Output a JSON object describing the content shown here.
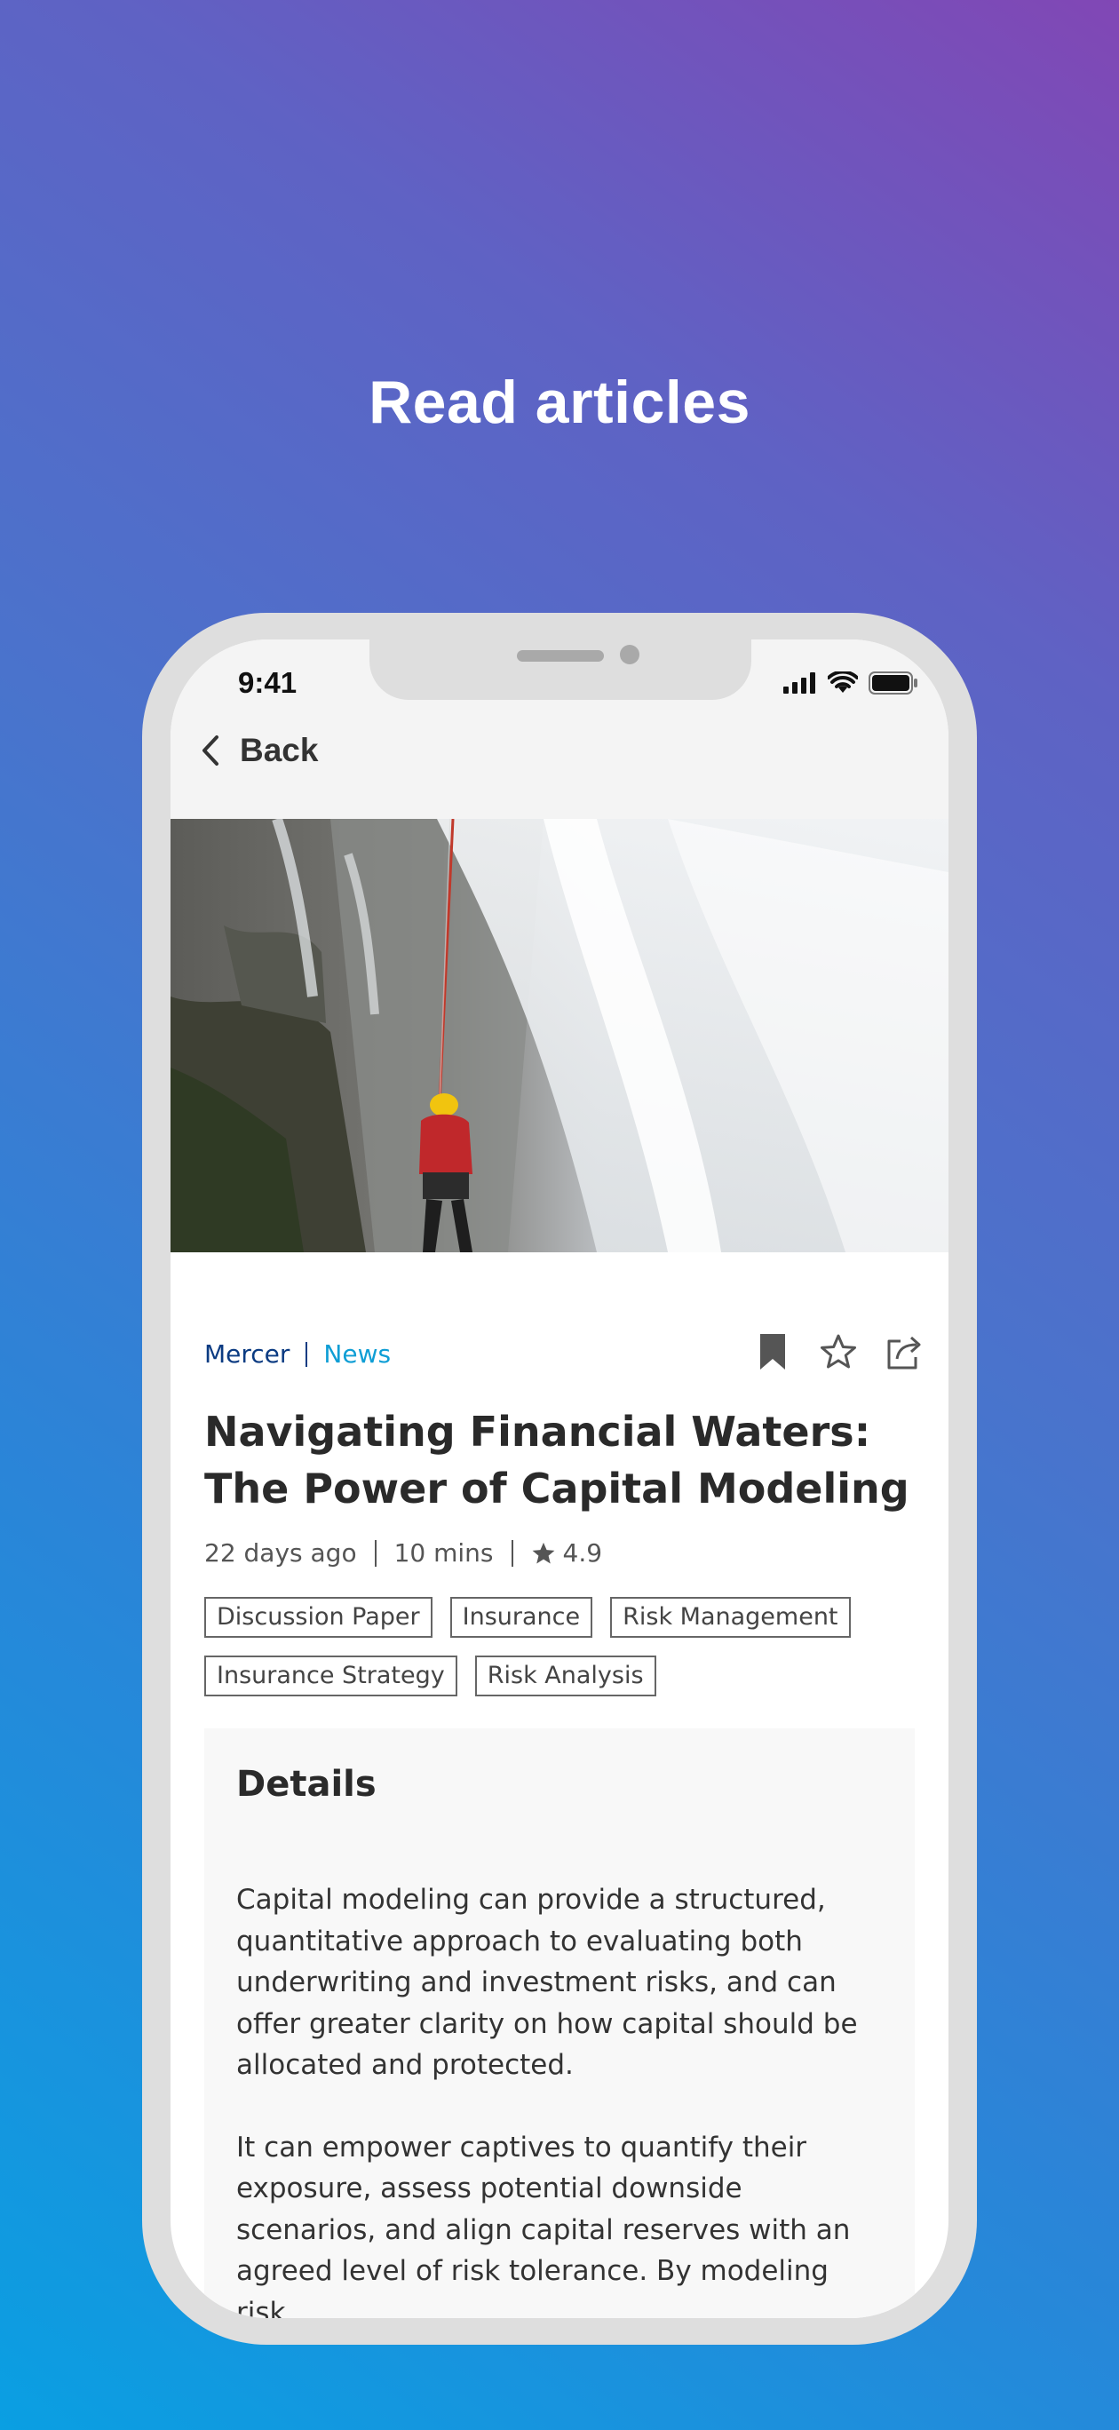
{
  "headline": "Read articles",
  "status_bar": {
    "time": "9:41"
  },
  "nav": {
    "back_label": "Back"
  },
  "article": {
    "source": "Mercer",
    "category": "News",
    "title": "Navigating Financial Waters: The Power of Capital Modeling",
    "age": "22 days ago",
    "read_time": "10 mins",
    "rating": "4.9",
    "tags": [
      "Discussion Paper",
      "Insurance",
      "Risk Management",
      "Insurance Strategy",
      "Risk Analysis"
    ],
    "details_heading": "Details",
    "paragraphs": [
      "Capital modeling can provide a structured, quantitative approach to evaluating both underwriting and investment risks, and can offer greater clarity on how capital should be allocated and protected.",
      "It can empower captives to quantify their exposure, assess potential downside scenarios, and align capital reserves with an agreed level of risk tolerance. By modeling risk"
    ]
  },
  "icons": {
    "back": "chevron-left-icon",
    "bookmark": "bookmark-icon",
    "favorite": "star-outline-icon",
    "share": "share-icon",
    "rating": "star-filled-icon"
  },
  "colors": {
    "source": "#0b3b82",
    "category": "#0f9ed5",
    "gradient_start": "#8147b5",
    "gradient_end": "#0a9fe2"
  }
}
